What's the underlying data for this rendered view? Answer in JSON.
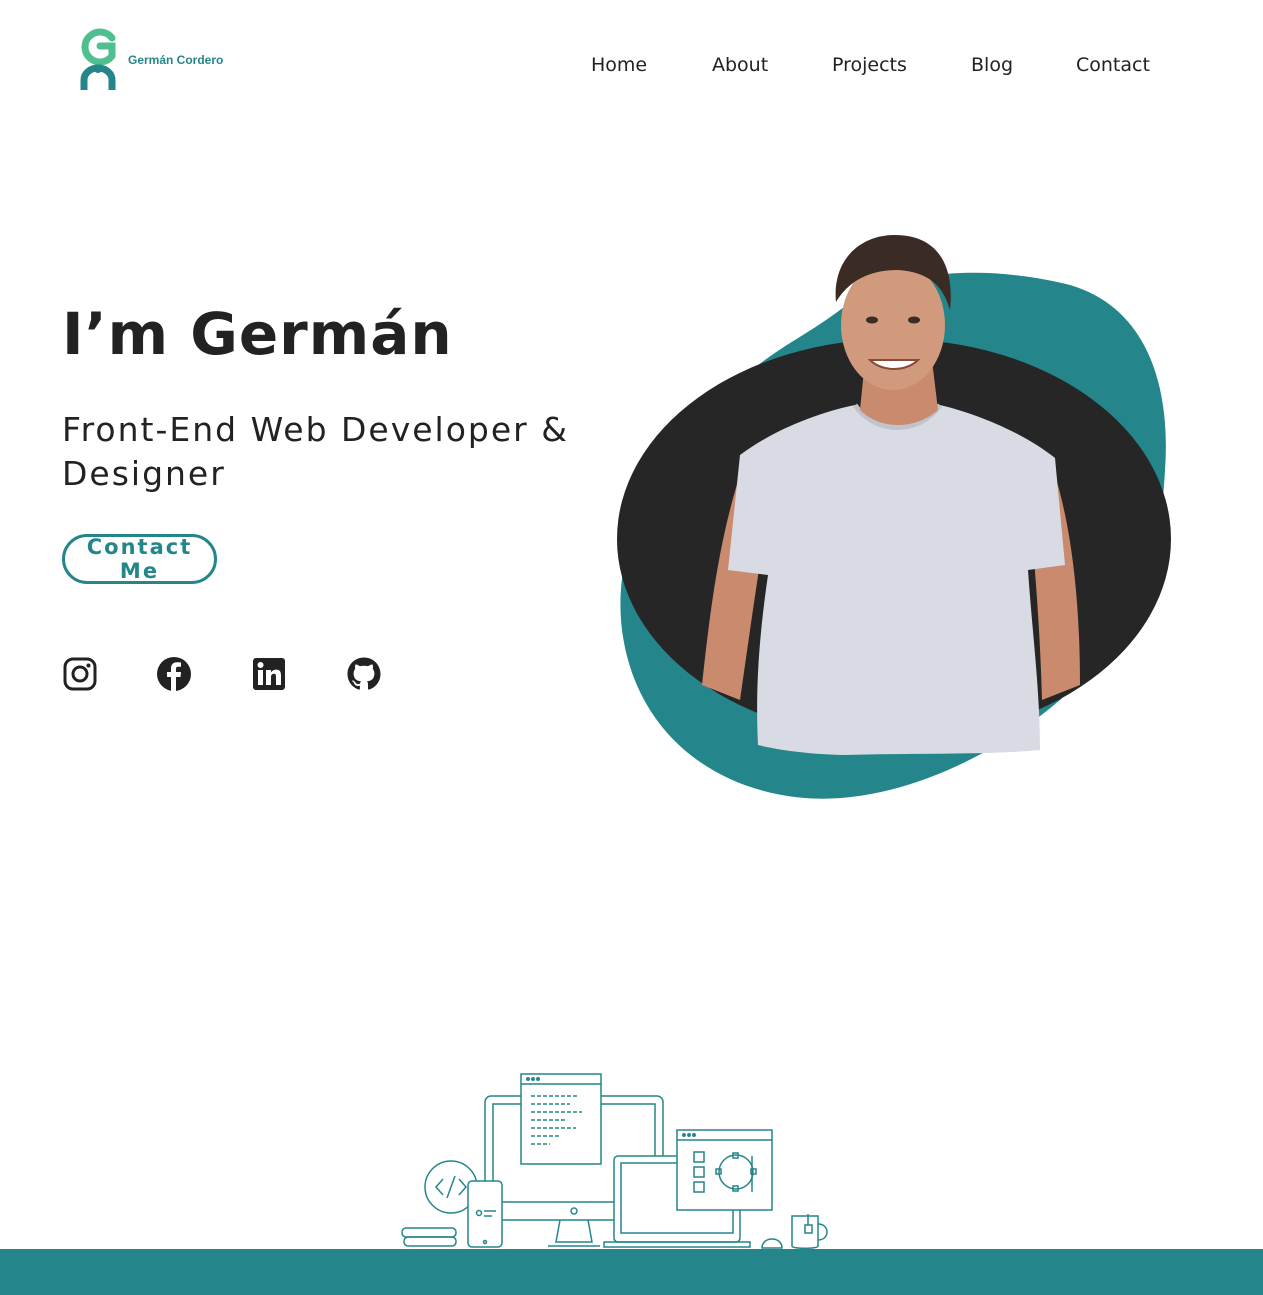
{
  "brand": {
    "name": "Germán Cordero",
    "logo_icon": "gc-monogram-logo",
    "accent_color": "#24868a",
    "dark_color": "#222222"
  },
  "nav": {
    "items": [
      {
        "label": "Home"
      },
      {
        "label": "About"
      },
      {
        "label": "Projects"
      },
      {
        "label": "Blog"
      },
      {
        "label": "Contact"
      }
    ]
  },
  "hero": {
    "title": "I’m Germán",
    "subtitle": "Front-End Web Developer & Designer",
    "cta_label": "Contact Me",
    "portrait_icon": "profile-photo"
  },
  "socials": [
    {
      "icon": "instagram-icon"
    },
    {
      "icon": "facebook-icon"
    },
    {
      "icon": "linkedin-icon"
    },
    {
      "icon": "github-icon"
    }
  ],
  "illustration": {
    "icon": "devices-illustration"
  }
}
